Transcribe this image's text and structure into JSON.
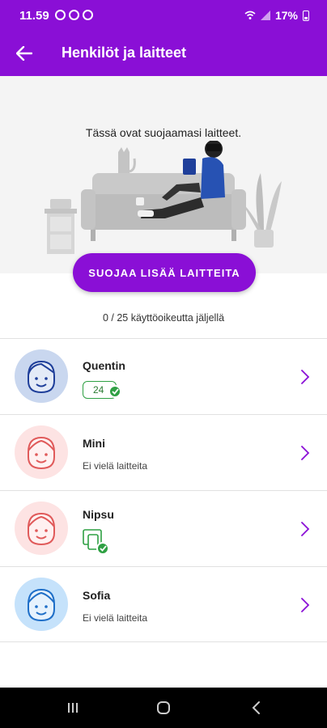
{
  "status_bar": {
    "time": "11.59",
    "battery": "17%",
    "left_icons": [
      "whatsapp-icon",
      "shield-icon",
      "shield-icon"
    ],
    "right_icons": [
      "wifi-icon",
      "signal-icon",
      "battery-icon"
    ]
  },
  "app_bar": {
    "title": "Henkilöt ja laitteet",
    "back_icon": "arrow-left-icon"
  },
  "hero": {
    "text": "Tässä ovat suojaamasi laitteet.",
    "cta_label": "SUOJAA LISÄÄ LAITTEITA"
  },
  "licenses_text": "0 / 25 käyttöoikeutta jäljellä",
  "people": [
    {
      "name": "Quentin",
      "badge_count": "24",
      "status": "",
      "avatar_color": "#c9d7ef",
      "face_color": "#1f3f9a"
    },
    {
      "name": "Mini",
      "badge_count": "",
      "status": "Ei vielä laitteita",
      "avatar_color": "#fde3e3",
      "face_color": "#e05a5a"
    },
    {
      "name": "Nipsu",
      "badge_count": "",
      "status": "",
      "avatar_color": "#fde3e3",
      "face_color": "#e05a5a"
    },
    {
      "name": "Sofia",
      "badge_count": "",
      "status": "Ei vielä laitteita",
      "avatar_color": "#c5e2fb",
      "face_color": "#1f6fc8"
    }
  ],
  "colors": {
    "brand": "#8a0fd6",
    "success": "#2ea043",
    "chevron": "#8a0fd6"
  },
  "nav_bar": {
    "icons": [
      "recent-apps-icon",
      "home-icon",
      "back-icon"
    ]
  }
}
